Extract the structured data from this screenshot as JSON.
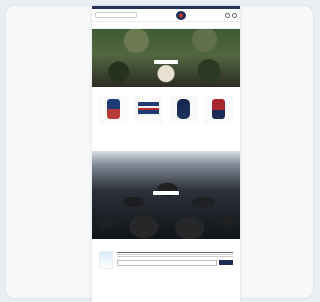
{
  "page": {
    "top_strip_text": "",
    "search_placeholder": "",
    "nav_items": [
      "",
      "",
      "",
      "",
      "",
      ""
    ],
    "hero_title": "",
    "hero_button": "",
    "products_section_title": "",
    "products_section_subtitle": "",
    "products": [
      {
        "name": "",
        "price": "",
        "stock": ""
      },
      {
        "name": "",
        "price": "",
        "stock": ""
      },
      {
        "name": "",
        "price": "",
        "stock": ""
      },
      {
        "name": "",
        "price": "",
        "stock": ""
      }
    ],
    "banner_title": "",
    "banner_button": "",
    "newsletter_title": "",
    "newsletter_button": ""
  },
  "colors": {
    "background": "#e9eef3",
    "brand_navy": "#1f2d57",
    "brand_red": "#c0392b",
    "link_blue": "#3a75c4",
    "in_stock_green": "#1f8f50"
  },
  "icons": {
    "logo": "brand-logo",
    "search": "search-icon",
    "cart": "cart-icon"
  }
}
